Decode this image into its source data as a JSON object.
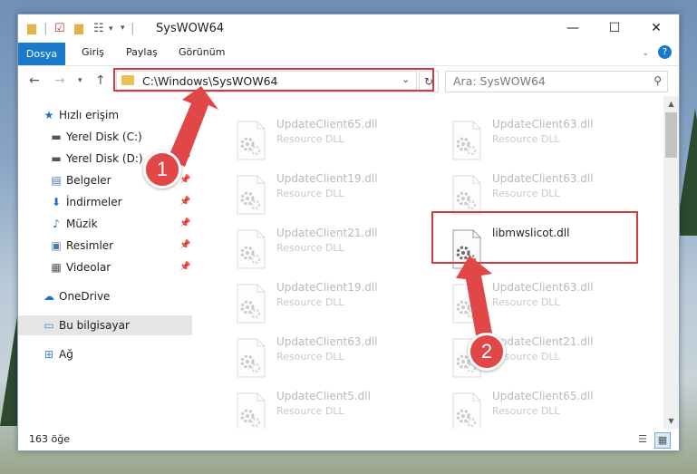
{
  "window": {
    "title": "SysWOW64",
    "controls": {
      "minimize": "—",
      "maximize": "☐",
      "close": "✕"
    }
  },
  "ribbon": {
    "file_tab": "Dosya",
    "tabs": [
      "Giriş",
      "Paylaş",
      "Görünüm"
    ],
    "expand_icon": "chevron-down-icon",
    "help_icon": "help-icon"
  },
  "navigation": {
    "address": "C:\\Windows\\SysWOW64",
    "search_placeholder": "Ara: SysWOW64"
  },
  "sidebar": {
    "items": [
      {
        "label": "Hızlı erişim",
        "icon": "star-icon",
        "pinned": false
      },
      {
        "label": "Yerel Disk (C:)",
        "icon": "drive-icon",
        "pinned": true
      },
      {
        "label": "Yerel Disk (D:)",
        "icon": "drive-icon",
        "pinned": true
      },
      {
        "label": "Belgeler",
        "icon": "documents-icon",
        "pinned": true
      },
      {
        "label": "İndirmeler",
        "icon": "downloads-icon",
        "pinned": true
      },
      {
        "label": "Müzik",
        "icon": "music-icon",
        "pinned": true
      },
      {
        "label": "Resimler",
        "icon": "pictures-icon",
        "pinned": true
      },
      {
        "label": "Videolar",
        "icon": "videos-icon",
        "pinned": true
      },
      {
        "label": "OneDrive",
        "icon": "cloud-icon",
        "pinned": false
      },
      {
        "label": "Bu bilgisayar",
        "icon": "computer-icon",
        "pinned": false,
        "selected": true
      },
      {
        "label": "Ağ",
        "icon": "network-icon",
        "pinned": false
      }
    ]
  },
  "files": [
    {
      "name": "UpdateClient65.dll",
      "type": "Resource DLL"
    },
    {
      "name": "UpdateClient63.dll",
      "type": "Resource DLL"
    },
    {
      "name": "UpdateClient19.dll",
      "type": "Resource DLL"
    },
    {
      "name": "UpdateClient63.dll",
      "type": "Resource DLL"
    },
    {
      "name": "UpdateClient21.dll",
      "type": "Resource DLL"
    },
    {
      "name": "libmwslicot.dll",
      "type": "",
      "highlighted": true
    },
    {
      "name": "UpdateClient19.dll",
      "type": "Resource DLL"
    },
    {
      "name": "UpdateClient63.dll",
      "type": "Resource DLL"
    },
    {
      "name": "UpdateClient63.dll",
      "type": "Resource DLL"
    },
    {
      "name": "UpdateClient21.dll",
      "type": "Resource DLL"
    },
    {
      "name": "UpdateClient5.dll",
      "type": "Resource DLL"
    },
    {
      "name": "UpdateClient65.dll",
      "type": "Resource DLL"
    }
  ],
  "status": {
    "count": "163 öğe"
  },
  "annotations": {
    "step1": "1",
    "step2": "2",
    "color": "#d23b3b"
  }
}
